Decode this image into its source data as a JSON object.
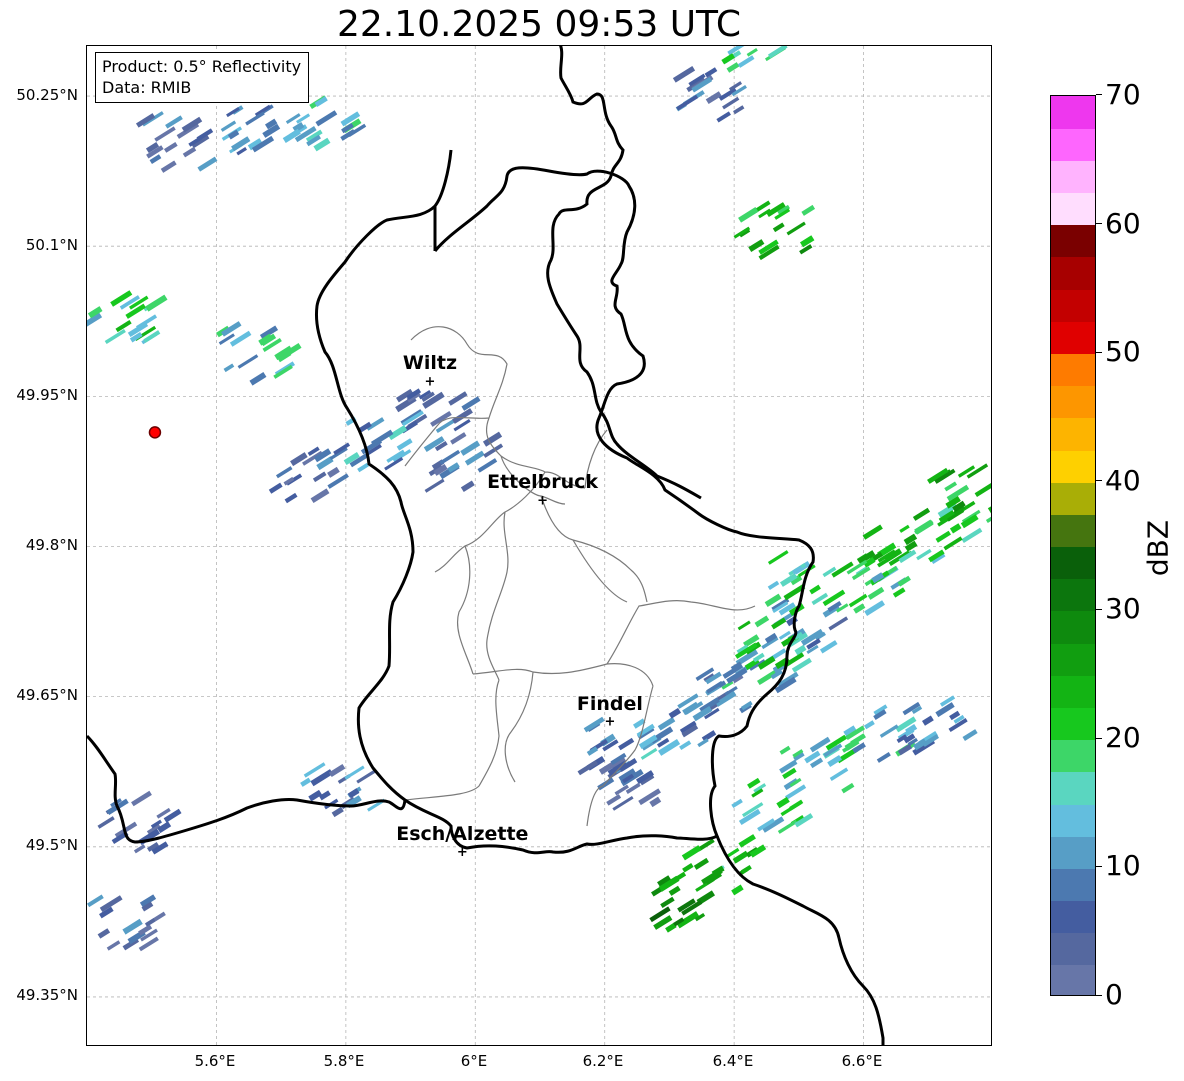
{
  "title": "22.10.2025 09:53 UTC",
  "info": {
    "product": "Product: 0.5° Reflectivity",
    "source": "Data: RMIB"
  },
  "cities": [
    {
      "name": "Wiltz",
      "lon": 5.93,
      "lat": 49.966
    },
    {
      "name": "Ettelbruck",
      "lon": 6.104,
      "lat": 49.847
    },
    {
      "name": "Findel",
      "lon": 6.208,
      "lat": 49.626
    },
    {
      "name": "Esch/Alzette",
      "lon": 5.98,
      "lat": 49.496
    }
  ],
  "radar_site": {
    "lon": 5.505,
    "lat": 49.914,
    "color": "#ff0000"
  },
  "axes": {
    "lon_range": [
      5.4,
      6.8
    ],
    "lat_range": [
      49.3,
      50.3
    ],
    "lon_ticks": [
      "5.6°E",
      "5.8°E",
      "6°E",
      "6.2°E",
      "6.4°E",
      "6.6°E"
    ],
    "lat_ticks": [
      "50.25°N",
      "50.1°N",
      "49.95°N",
      "49.8°N",
      "49.65°N",
      "49.5°N",
      "49.35°N"
    ]
  },
  "colorbar": {
    "label": "dBZ",
    "ticks": [
      "0",
      "10",
      "20",
      "30",
      "40",
      "50",
      "60",
      "70"
    ],
    "vmin": 0,
    "vmax": 70,
    "colors": [
      "#6776a8",
      "#55689f",
      "#445da0",
      "#4c79b0",
      "#579ec6",
      "#63bede",
      "#5ad6c0",
      "#3dd668",
      "#17c81e",
      "#13b414",
      "#119e10",
      "#0e8a0e",
      "#0c760d",
      "#0a600a",
      "#45750f",
      "#a9ae06",
      "#fed000",
      "#fdb400",
      "#fd9600",
      "#fe7b00",
      "#e00000",
      "#c30000",
      "#a70000",
      "#7a0000",
      "#ffddfe",
      "#ffb3fe",
      "#fe66fe",
      "#ee37ee"
    ]
  },
  "echoes": [
    {
      "lon": 5.52,
      "lat": 50.2,
      "dbz": 6
    },
    {
      "lon": 5.66,
      "lat": 50.21,
      "dbz": 10
    },
    {
      "lon": 5.75,
      "lat": 50.22,
      "dbz": 14
    },
    {
      "lon": 6.35,
      "lat": 50.25,
      "dbz": 6
    },
    {
      "lon": 6.41,
      "lat": 50.3,
      "dbz": 18
    },
    {
      "lon": 6.45,
      "lat": 50.11,
      "dbz": 24
    },
    {
      "lon": 5.93,
      "lat": 49.93,
      "dbz": 5
    },
    {
      "lon": 5.96,
      "lat": 49.88,
      "dbz": 8
    },
    {
      "lon": 5.84,
      "lat": 49.9,
      "dbz": 10
    },
    {
      "lon": 5.73,
      "lat": 49.87,
      "dbz": 6
    },
    {
      "lon": 5.65,
      "lat": 49.99,
      "dbz": 14
    },
    {
      "lon": 5.44,
      "lat": 50.02,
      "dbz": 18
    },
    {
      "lon": 5.47,
      "lat": 49.52,
      "dbz": 5
    },
    {
      "lon": 5.45,
      "lat": 49.42,
      "dbz": 6
    },
    {
      "lon": 5.78,
      "lat": 49.55,
      "dbz": 8
    },
    {
      "lon": 6.23,
      "lat": 49.56,
      "dbz": 6
    },
    {
      "lon": 6.21,
      "lat": 49.6,
      "dbz": 10
    },
    {
      "lon": 6.31,
      "lat": 49.44,
      "dbz": 28
    },
    {
      "lon": 6.37,
      "lat": 49.48,
      "dbz": 22
    },
    {
      "lon": 6.44,
      "lat": 49.54,
      "dbz": 18
    },
    {
      "lon": 6.52,
      "lat": 49.58,
      "dbz": 16
    },
    {
      "lon": 6.62,
      "lat": 49.61,
      "dbz": 14
    },
    {
      "lon": 6.7,
      "lat": 49.62,
      "dbz": 10
    },
    {
      "lon": 6.43,
      "lat": 49.68,
      "dbz": 12
    },
    {
      "lon": 6.5,
      "lat": 49.72,
      "dbz": 10
    },
    {
      "lon": 6.6,
      "lat": 49.76,
      "dbz": 16
    },
    {
      "lon": 6.7,
      "lat": 49.81,
      "dbz": 20
    },
    {
      "lon": 6.75,
      "lat": 49.85,
      "dbz": 24
    },
    {
      "lon": 6.62,
      "lat": 49.79,
      "dbz": 22
    },
    {
      "lon": 6.5,
      "lat": 49.76,
      "dbz": 18
    },
    {
      "lon": 6.45,
      "lat": 49.7,
      "dbz": 20
    },
    {
      "lon": 6.39,
      "lat": 49.65,
      "dbz": 6
    },
    {
      "lon": 6.3,
      "lat": 49.62,
      "dbz": 8
    }
  ]
}
